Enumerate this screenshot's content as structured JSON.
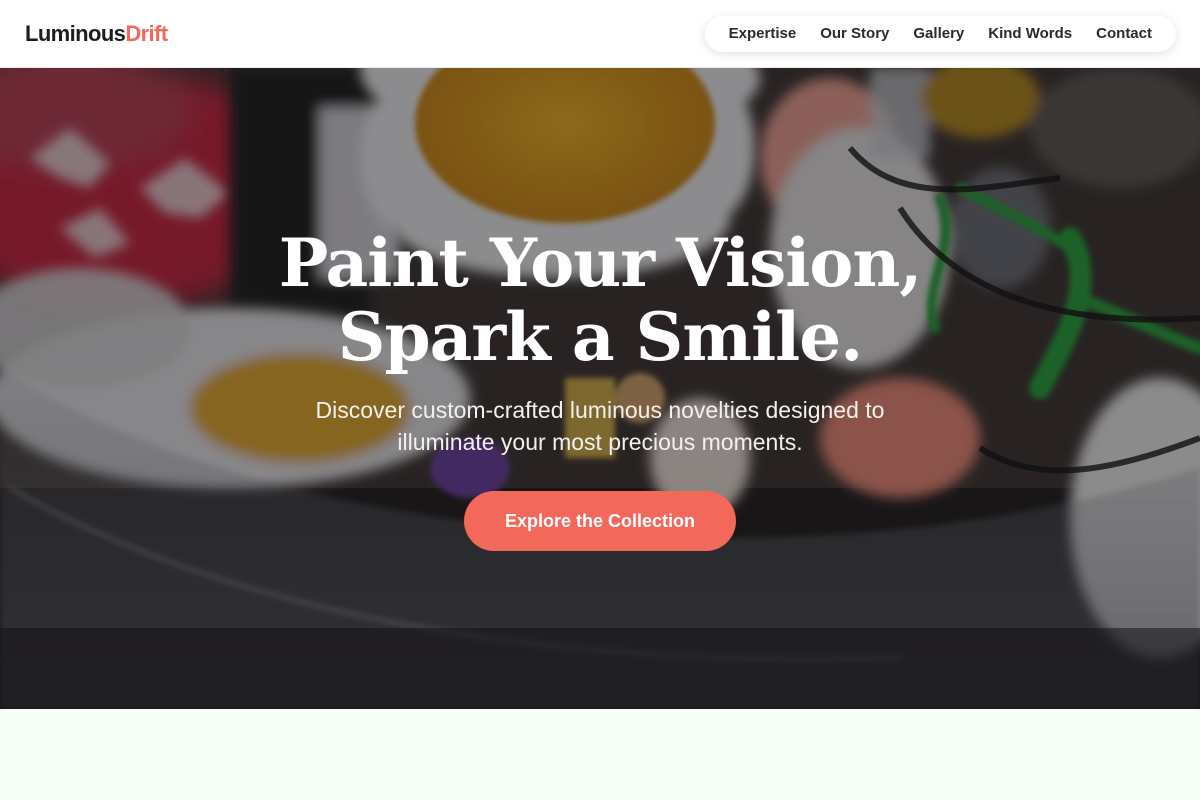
{
  "brand": {
    "name_primary": "Luminous",
    "name_accent": "Drift",
    "accent_color": "#f2695c"
  },
  "nav": {
    "items": [
      {
        "label": "Expertise"
      },
      {
        "label": "Our Story"
      },
      {
        "label": "Gallery"
      },
      {
        "label": "Kind Words"
      },
      {
        "label": "Contact"
      }
    ]
  },
  "hero": {
    "title_line1": "Paint Your Vision,",
    "title_line2": "Spark a Smile.",
    "subtitle": "Discover custom-crafted luminous novelties designed to illuminate your most precious moments.",
    "cta_label": "Explore the Collection",
    "cta_color": "#f2685b",
    "background_description_icon": "crochet-flowers-photo"
  },
  "colors": {
    "next_section_bg": "#f6fff4",
    "header_bg": "#ffffff"
  }
}
